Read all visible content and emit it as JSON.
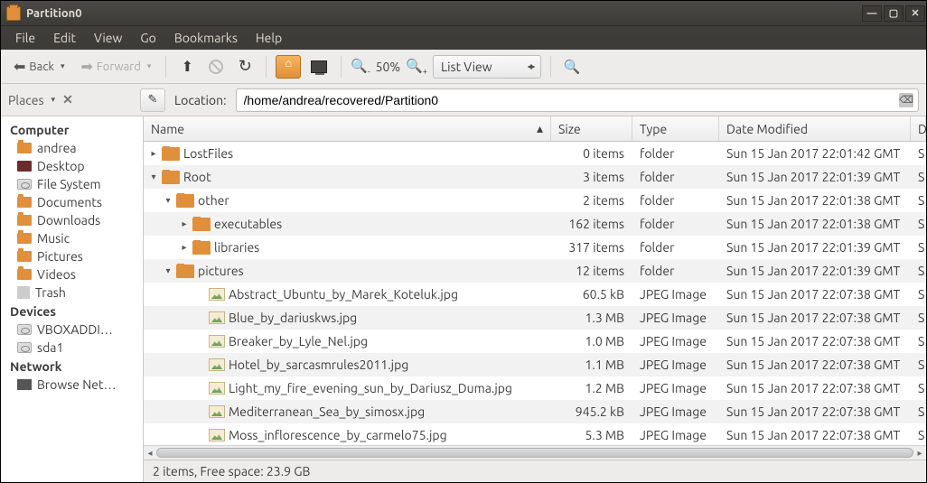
{
  "title": "Partition0",
  "menubar": [
    "File",
    "Edit",
    "View",
    "Go",
    "Bookmarks",
    "Help"
  ],
  "toolbar": {
    "back": "Back",
    "forward": "Forward",
    "zoom": "50%",
    "view_mode": "List View"
  },
  "location": {
    "places_label": "Places",
    "label": "Location:",
    "path": "/home/andrea/recovered/Partition0"
  },
  "sidebar": {
    "groups": [
      {
        "title": "Computer",
        "items": [
          {
            "icon": "folder",
            "label": "andrea"
          },
          {
            "icon": "desktop",
            "label": "Desktop"
          },
          {
            "icon": "drive",
            "label": "File System"
          },
          {
            "icon": "folder",
            "label": "Documents"
          },
          {
            "icon": "folder",
            "label": "Downloads"
          },
          {
            "icon": "folder",
            "label": "Music"
          },
          {
            "icon": "folder",
            "label": "Pictures"
          },
          {
            "icon": "folder",
            "label": "Videos"
          },
          {
            "icon": "trash",
            "label": "Trash"
          }
        ]
      },
      {
        "title": "Devices",
        "items": [
          {
            "icon": "drive",
            "label": "VBOXADDI…"
          },
          {
            "icon": "drive",
            "label": "sda1"
          }
        ]
      },
      {
        "title": "Network",
        "items": [
          {
            "icon": "net",
            "label": "Browse Net…"
          }
        ]
      }
    ]
  },
  "columns": {
    "name": "Name",
    "size": "Size",
    "type": "Type",
    "date": "Date Modified"
  },
  "rows": [
    {
      "indent": 0,
      "exp": "▸",
      "kind": "folder",
      "name": "LostFiles",
      "size": "0 items",
      "type": "folder",
      "date": "Sun 15 Jan 2017 22:01:42 GMT",
      "s": "S"
    },
    {
      "indent": 0,
      "exp": "▾",
      "kind": "folder",
      "name": "Root",
      "size": "3 items",
      "type": "folder",
      "date": "Sun 15 Jan 2017 22:01:39 GMT",
      "s": "S"
    },
    {
      "indent": 1,
      "exp": "▾",
      "kind": "folder",
      "name": "other",
      "size": "2 items",
      "type": "folder",
      "date": "Sun 15 Jan 2017 22:01:38 GMT",
      "s": "S"
    },
    {
      "indent": 2,
      "exp": "▸",
      "kind": "folder",
      "name": "executables",
      "size": "162 items",
      "type": "folder",
      "date": "Sun 15 Jan 2017 22:01:38 GMT",
      "s": "S"
    },
    {
      "indent": 2,
      "exp": "▸",
      "kind": "folder",
      "name": "libraries",
      "size": "317 items",
      "type": "folder",
      "date": "Sun 15 Jan 2017 22:01:39 GMT",
      "s": "S"
    },
    {
      "indent": 1,
      "exp": "▾",
      "kind": "folder",
      "name": "pictures",
      "size": "12 items",
      "type": "folder",
      "date": "Sun 15 Jan 2017 22:01:39 GMT",
      "s": "S"
    },
    {
      "indent": 3,
      "exp": "",
      "kind": "img",
      "name": "Abstract_Ubuntu_by_Marek_Koteluk.jpg",
      "size": "60.5 kB",
      "type": "JPEG Image",
      "date": "Sun 15 Jan 2017 22:07:38 GMT",
      "s": "S"
    },
    {
      "indent": 3,
      "exp": "",
      "kind": "img",
      "name": "Blue_by_dariuskws.jpg",
      "size": "1.3 MB",
      "type": "JPEG Image",
      "date": "Sun 15 Jan 2017 22:07:38 GMT",
      "s": "S"
    },
    {
      "indent": 3,
      "exp": "",
      "kind": "img",
      "name": "Breaker_by_Lyle_Nel.jpg",
      "size": "1.0 MB",
      "type": "JPEG Image",
      "date": "Sun 15 Jan 2017 22:07:38 GMT",
      "s": "S"
    },
    {
      "indent": 3,
      "exp": "",
      "kind": "img",
      "name": "Hotel_by_sarcasmrules2011.jpg",
      "size": "1.1 MB",
      "type": "JPEG Image",
      "date": "Sun 15 Jan 2017 22:07:38 GMT",
      "s": "S"
    },
    {
      "indent": 3,
      "exp": "",
      "kind": "img",
      "name": "Light_my_fire_evening_sun_by_Dariusz_Duma.jpg",
      "size": "1.2 MB",
      "type": "JPEG Image",
      "date": "Sun 15 Jan 2017 22:07:38 GMT",
      "s": "S"
    },
    {
      "indent": 3,
      "exp": "",
      "kind": "img",
      "name": "Mediterranean_Sea_by_simosx.jpg",
      "size": "945.2 kB",
      "type": "JPEG Image",
      "date": "Sun 15 Jan 2017 22:07:38 GMT",
      "s": "S"
    },
    {
      "indent": 3,
      "exp": "",
      "kind": "img",
      "name": "Moss_inflorescence_by_carmelo75.jpg",
      "size": "5.3 MB",
      "type": "JPEG Image",
      "date": "Sun 15 Jan 2017 22:07:38 GMT",
      "s": "S"
    }
  ],
  "status": "2 items, Free space: 23.9 GB"
}
